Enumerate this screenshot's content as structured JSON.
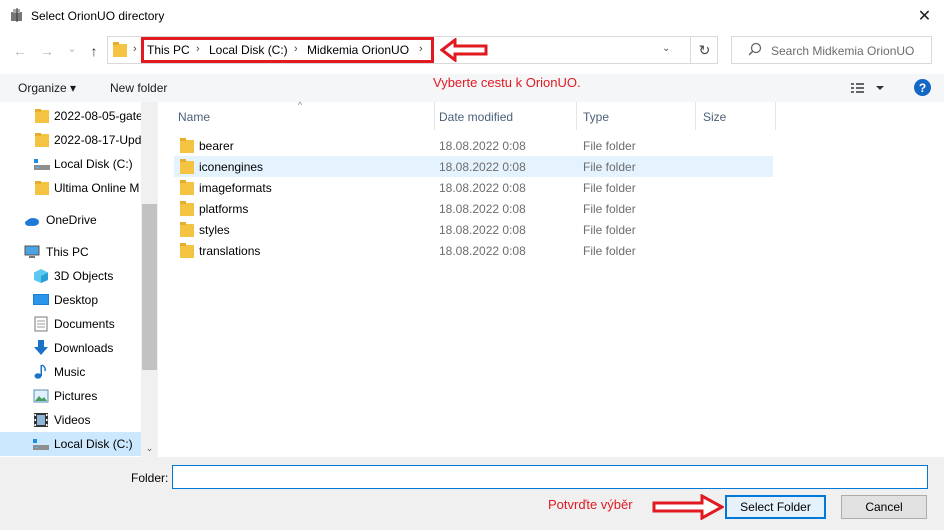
{
  "window": {
    "title": "Select OrionUO directory",
    "close_glyph": "✕"
  },
  "nav": {
    "back_glyph": "←",
    "forward_glyph": "→",
    "recent_glyph": "⌄",
    "up_glyph": "↑",
    "address": {
      "crumbs": [
        "This PC",
        "Local Disk (C:)",
        "Midkemia OrionUO"
      ],
      "separator": "›",
      "dropdown_glyph": "⌄",
      "refresh_glyph": "↻"
    },
    "search_placeholder": "Search Midkemia OrionUO"
  },
  "toolbar": {
    "organize_label": "Organize ▾",
    "new_folder_label": "New folder",
    "help_label": "?"
  },
  "annotations": {
    "path_hint": "Vyberte cestu k OrionUO.",
    "confirm_hint": "Potvrďte výběr",
    "color": "#e11a22"
  },
  "sidebar": {
    "items": [
      {
        "label": "2022-08-05-gate",
        "icon": "folder-icon"
      },
      {
        "label": "2022-08-17-Upd",
        "icon": "folder-icon"
      },
      {
        "label": "Local Disk (C:)",
        "icon": "drive-icon"
      },
      {
        "label": "Ultima Online M",
        "icon": "folder-icon"
      },
      {
        "label": "OneDrive",
        "icon": "cloud-icon"
      },
      {
        "label": "This PC",
        "icon": "computer-icon"
      },
      {
        "label": "3D Objects",
        "icon": "cube-icon"
      },
      {
        "label": "Desktop",
        "icon": "desktop-icon"
      },
      {
        "label": "Documents",
        "icon": "document-icon"
      },
      {
        "label": "Downloads",
        "icon": "download-icon"
      },
      {
        "label": "Music",
        "icon": "music-icon"
      },
      {
        "label": "Pictures",
        "icon": "picture-icon"
      },
      {
        "label": "Videos",
        "icon": "video-icon"
      },
      {
        "label": "Local Disk (C:)",
        "icon": "drive-icon"
      }
    ],
    "scroll_down_glyph": "⌄"
  },
  "file_list": {
    "columns": {
      "name": "Name",
      "date": "Date modified",
      "type": "Type",
      "size": "Size"
    },
    "sort_glyph": "^",
    "rows": [
      {
        "name": "bearer",
        "date": "18.08.2022 0:08",
        "type": "File folder"
      },
      {
        "name": "iconengines",
        "date": "18.08.2022 0:08",
        "type": "File folder"
      },
      {
        "name": "imageformats",
        "date": "18.08.2022 0:08",
        "type": "File folder"
      },
      {
        "name": "platforms",
        "date": "18.08.2022 0:08",
        "type": "File folder"
      },
      {
        "name": "styles",
        "date": "18.08.2022 0:08",
        "type": "File folder"
      },
      {
        "name": "translations",
        "date": "18.08.2022 0:08",
        "type": "File folder"
      }
    ]
  },
  "footer": {
    "folder_label": "Folder:",
    "folder_value": "",
    "select_label": "Select Folder",
    "cancel_label": "Cancel"
  },
  "colors": {
    "accent": "#0078d7",
    "folder": "#f5c342",
    "selection": "#cce8ff"
  }
}
